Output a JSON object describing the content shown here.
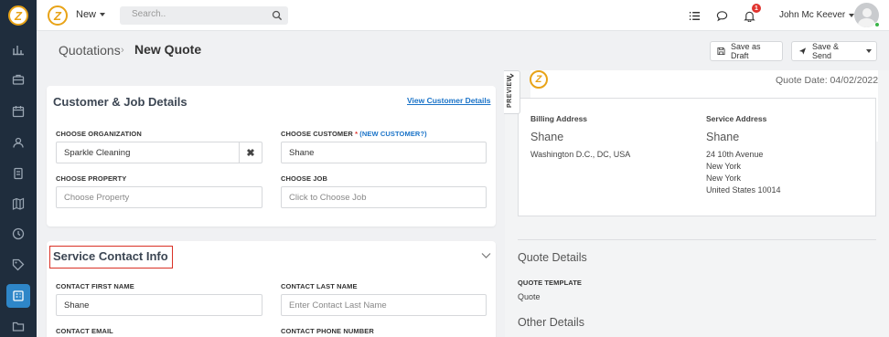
{
  "topbar": {
    "new_label": "New",
    "search_placeholder": "Search..",
    "notification_count": "1",
    "user_name": "John Mc Keever"
  },
  "breadcrumb": {
    "parent": "Quotations",
    "separator": "›",
    "current": "New Quote"
  },
  "actions": {
    "save_draft": "Save as Draft",
    "save_send": "Save & Send"
  },
  "customer_card": {
    "title": "Customer & Job Details",
    "view_link": "View Customer Details",
    "org_label": "CHOOSE ORGANIZATION",
    "org_value": "Sparkle Cleaning",
    "org_clear": "✖",
    "customer_label": "CHOOSE CUSTOMER",
    "customer_required": "*",
    "customer_new": "(NEW CUSTOMER?)",
    "customer_value": "Shane",
    "property_label": "CHOOSE PROPERTY",
    "property_placeholder": "Choose Property",
    "job_label": "CHOOSE JOB",
    "job_placeholder": "Click to Choose Job"
  },
  "contact_card": {
    "title": "Service Contact Info",
    "first_name_label": "CONTACT FIRST NAME",
    "first_name_value": "Shane",
    "last_name_label": "CONTACT LAST NAME",
    "last_name_placeholder": "Enter Contact Last Name",
    "email_label": "CONTACT EMAIL",
    "phone_label": "CONTACT PHONE NUMBER"
  },
  "preview": {
    "tab_label": "PREVIEW",
    "quote_date": "Quote Date: 04/02/2022",
    "billing_heading": "Billing Address",
    "billing_name": "Shane",
    "billing_line1": "Washington D.C., DC, USA",
    "service_heading": "Service Address",
    "service_name": "Shane",
    "service_line1": "24 10th Avenue",
    "service_line2": "New York",
    "service_line3": "New York",
    "service_line4": "United States 10014",
    "quote_details_heading": "Quote Details",
    "template_label": "QUOTE TEMPLATE",
    "template_value": "Quote",
    "other_details_heading": "Other Details"
  },
  "colors": {
    "sidebar": "#1f2d3d",
    "accent": "#2e86c8",
    "link": "#1a73c8",
    "highlight": "#d93025",
    "logo": "#e8a317"
  }
}
